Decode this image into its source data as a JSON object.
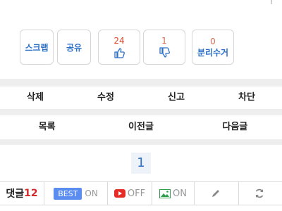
{
  "vote": {
    "scrap_label": "스크랩",
    "share_label": "공유",
    "like_count": "24",
    "dislike_count": "1",
    "separate_count": "0",
    "separate_label": "분리수거"
  },
  "actions": {
    "delete_label": "삭제",
    "edit_label": "수정",
    "report_label": "신고",
    "block_label": "차단"
  },
  "nav": {
    "list_label": "목록",
    "prev_label": "이전글",
    "next_label": "다음글"
  },
  "pagination": {
    "current_page": "1"
  },
  "bottom_bar": {
    "comments_label": "댓글",
    "comments_count": "12",
    "best_badge": "BEST",
    "best_state": "ON",
    "youtube_state": "OFF",
    "image_state": "ON"
  },
  "colors": {
    "accent_blue": "#2c6fc7",
    "count_red": "#e0452b",
    "best_blue": "#5b8df0",
    "youtube_red": "#e52d27",
    "image_green": "#2e9e4f"
  }
}
